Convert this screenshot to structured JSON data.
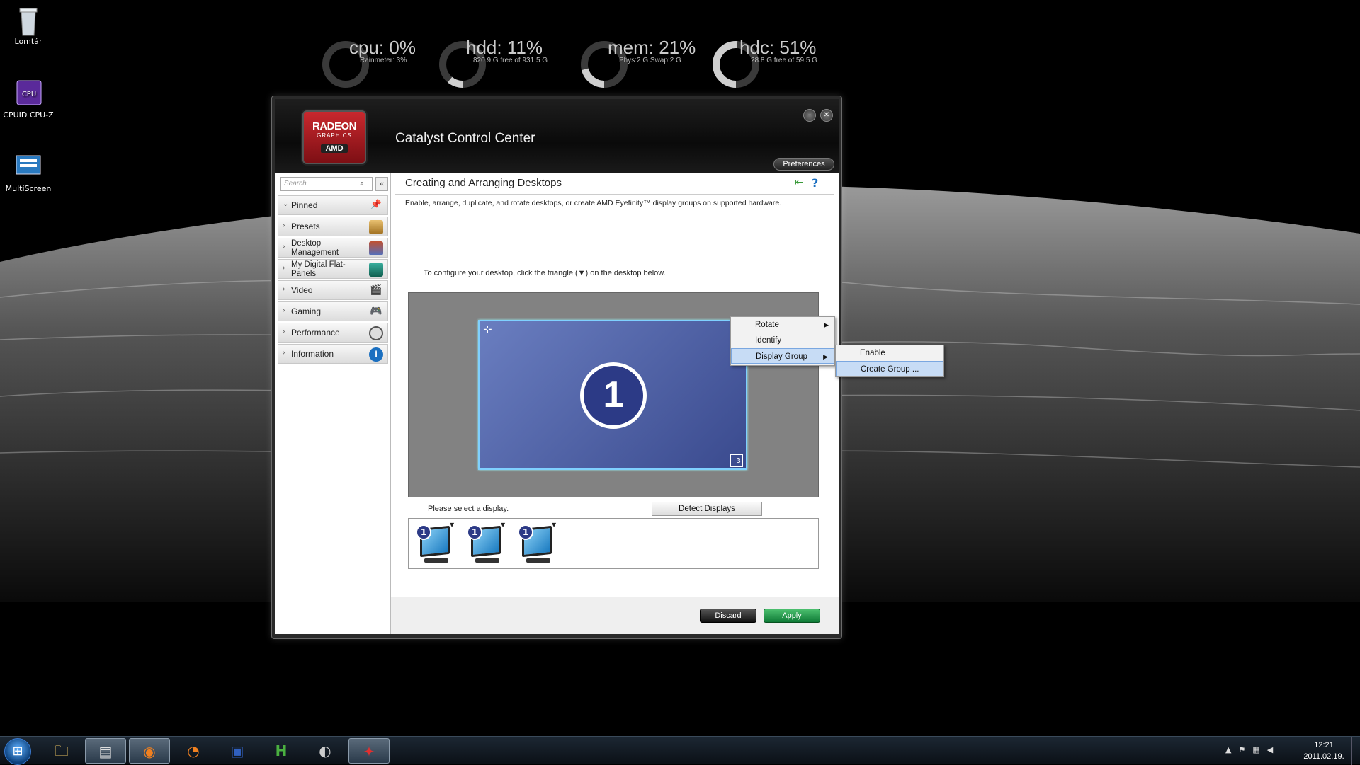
{
  "desktop": {
    "icons": [
      {
        "label": "Lomtár"
      },
      {
        "label": "CPUID CPU-Z"
      },
      {
        "label": "MultiScreen"
      }
    ]
  },
  "rainmeter": [
    {
      "title": "cpu: 0%",
      "sub": "Rainmeter: 3%",
      "level": 0.0
    },
    {
      "title": "hdd: 11%",
      "sub": "820.9 G free of 931.5 G",
      "level": 0.11
    },
    {
      "title": "mem: 21%",
      "sub": "Phys:2 G Swap:2 G",
      "level": 0.21
    },
    {
      "title": "hdc: 51%",
      "sub": "28.8 G free of 59.5 G",
      "level": 0.51
    }
  ],
  "app": {
    "logo": {
      "line1": "RADEON",
      "line2": "GRAPHICS",
      "line3": "AMD"
    },
    "title": "Catalyst Control Center",
    "preferences": "Preferences",
    "search_placeholder": "Search",
    "nav": [
      {
        "label": "Pinned"
      },
      {
        "label": "Presets"
      },
      {
        "label": "Desktop\nManagement"
      },
      {
        "label": "My Digital Flat-\nPanels"
      },
      {
        "label": "Video"
      },
      {
        "label": "Gaming"
      },
      {
        "label": "Performance"
      },
      {
        "label": "Information"
      }
    ],
    "page_title": "Creating and Arranging Desktops",
    "description": "Enable, arrange, duplicate, and rotate desktops, or create AMD Eyefinity™ display groups on supported hardware.",
    "instruction": "To configure your desktop, click the triangle (▼) on the desktop below.",
    "display_number": "1",
    "display_corner": "3",
    "context_menu": [
      {
        "label": "Rotate",
        "submenu": true
      },
      {
        "label": "Identify",
        "submenu": false
      },
      {
        "label": "Display Group",
        "submenu": true
      }
    ],
    "submenu": [
      {
        "label": "Enable"
      },
      {
        "label": "Create Group ..."
      }
    ],
    "select_prompt": "Please select a display.",
    "detect_button": "Detect Displays",
    "displays": [
      {
        "badge": "1"
      },
      {
        "badge": "1"
      },
      {
        "badge": "1"
      }
    ],
    "discard": "Discard",
    "apply": "Apply"
  },
  "taskbar": {
    "clock_time": "12:21",
    "clock_date": "2011.02.19."
  },
  "colors": {
    "accent": "#2c3a86",
    "apply_green": "#0e7a36",
    "brand_red": "#c9282e"
  }
}
